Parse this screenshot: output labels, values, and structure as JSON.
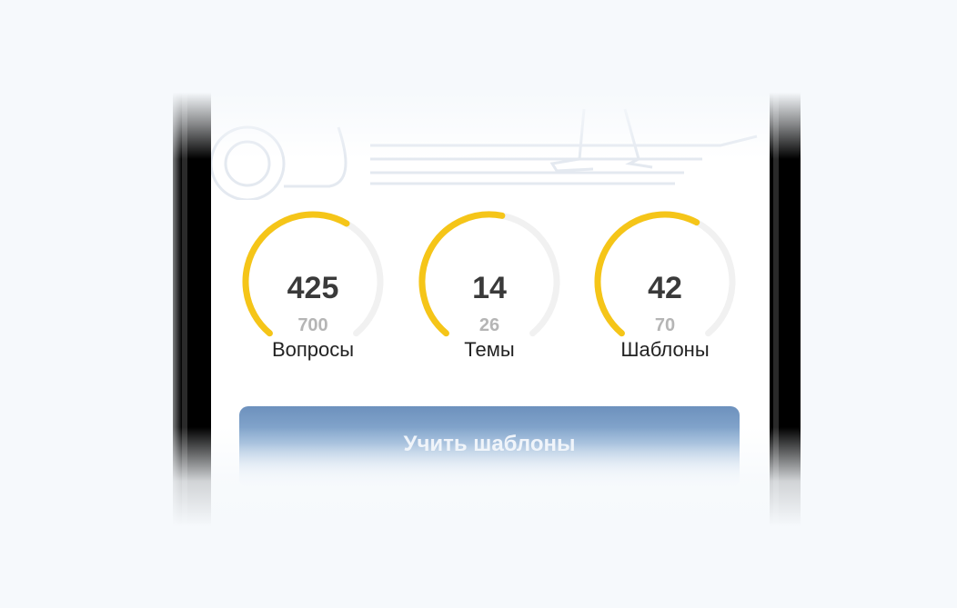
{
  "stats": [
    {
      "value": "425",
      "total": "700",
      "label": "Вопросы",
      "progress": 0.6071
    },
    {
      "value": "14",
      "total": "26",
      "label": "Темы",
      "progress": 0.5385
    },
    {
      "value": "42",
      "total": "70",
      "label": "Шаблоны",
      "progress": 0.6
    }
  ],
  "cta": {
    "label": "Учить шаблоны"
  },
  "colors": {
    "progress": "#f5c518",
    "track": "#f1f1f1",
    "value_text": "#3a3a3a",
    "total_text": "#b5b5b5",
    "cta_top": "#6d91bd"
  }
}
